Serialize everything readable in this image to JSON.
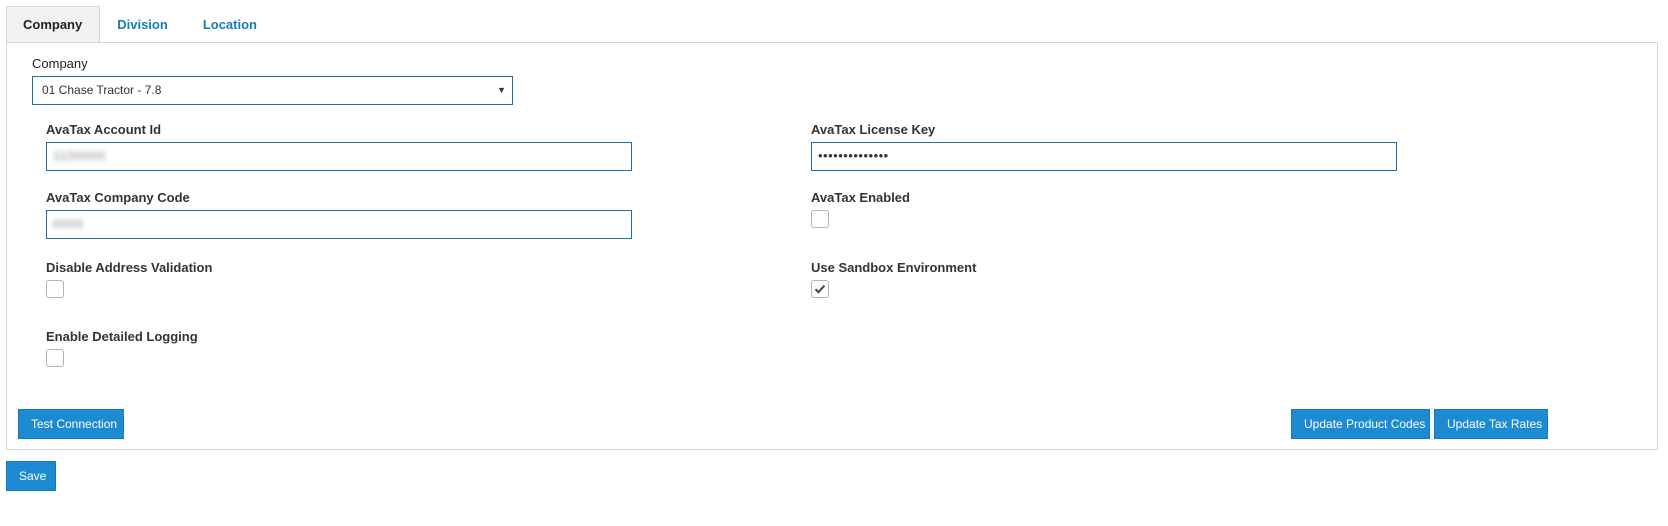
{
  "tabs": [
    {
      "label": "Company",
      "active": true
    },
    {
      "label": "Division",
      "active": false
    },
    {
      "label": "Location",
      "active": false
    }
  ],
  "company_select": {
    "label": "Company",
    "value": "01 Chase Tractor - 7.8"
  },
  "fields": {
    "account_id": {
      "label": "AvaTax Account Id",
      "value": "1100000"
    },
    "license_key": {
      "label": "AvaTax License Key",
      "value": "••••••••••••••"
    },
    "company_code": {
      "label": "AvaTax Company Code",
      "value": "0000"
    },
    "avatax_enabled": {
      "label": "AvaTax Enabled",
      "checked": false
    },
    "disable_address_validation": {
      "label": "Disable Address Validation",
      "checked": false
    },
    "use_sandbox": {
      "label": "Use Sandbox Environment",
      "checked": true
    },
    "enable_detailed_logging": {
      "label": "Enable Detailed Logging",
      "checked": false
    }
  },
  "buttons": {
    "test_connection": "Test Connection",
    "update_product_codes": "Update Product Codes",
    "update_tax_rates": "Update Tax Rates",
    "save": "Save"
  },
  "colors": {
    "accent": "#1d8bd1",
    "tab_link": "#1a7ab8",
    "input_border": "#1a6fa8"
  }
}
